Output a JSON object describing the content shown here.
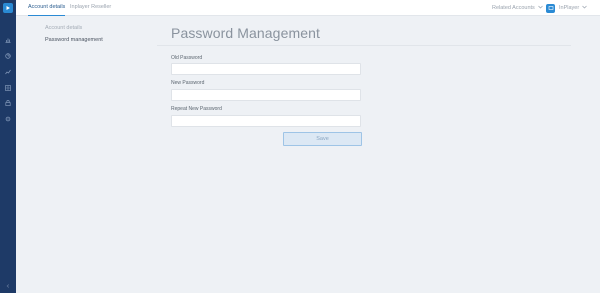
{
  "topbar": {
    "tabs": [
      {
        "label": "Account details",
        "active": true
      },
      {
        "label": "Inplayer Reseller",
        "active": false
      }
    ],
    "related_accounts_label": "Related Accounts",
    "user_label": "InPlayer"
  },
  "sidebar_icons": [
    "play-logo-icon",
    "chart-icon",
    "pie-chart-icon",
    "analytics-icon",
    "grid-icon",
    "lock-icon",
    "gear-icon",
    "collapse-icon"
  ],
  "submenu": {
    "heading": "Account details",
    "items": [
      {
        "label": "Password management"
      }
    ]
  },
  "main": {
    "title": "Password Management",
    "fields": [
      {
        "label": "Old Password",
        "value": "",
        "placeholder": ""
      },
      {
        "label": "New Password",
        "value": "",
        "placeholder": ""
      },
      {
        "label": "Repeat New Password",
        "value": "",
        "placeholder": ""
      }
    ],
    "save_label": "Save"
  },
  "colors": {
    "rail": "#1e3a67",
    "accent": "#2a8ad4",
    "background": "#eef1f5"
  }
}
